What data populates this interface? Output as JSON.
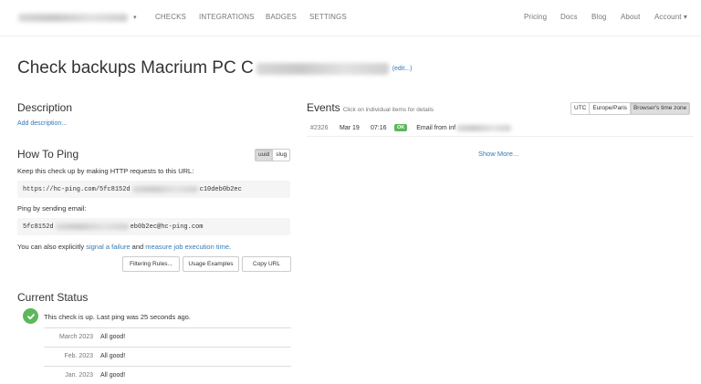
{
  "navbar": {
    "project_caret": "▾",
    "links_left": [
      "CHECKS",
      "INTEGRATIONS",
      "BADGES",
      "SETTINGS"
    ],
    "links_right": [
      "Pricing",
      "Docs",
      "Blog",
      "About"
    ],
    "account_label": "Account ▾"
  },
  "check": {
    "title": "Check backups Macrium PC C",
    "edit_label": "(edit...)"
  },
  "description": {
    "heading": "Description",
    "add_link": "Add description..."
  },
  "how_to_ping": {
    "heading": "How To Ping",
    "toggle_options": [
      "uuid",
      "slug"
    ],
    "toggle_selected": "uuid",
    "intro": "Keep this check up by making HTTP requests to this URL:",
    "url_prefix": "https://hc-ping.com/5fc8152d",
    "url_suffix": "c10deb0b2ec",
    "email_intro": "Ping by sending email:",
    "email_prefix": "5fc8152d",
    "email_suffix": "eb0b2ec@hc-ping.com",
    "explicit_prefix": "You can also explicitly",
    "signal_failure_link": "signal a failure",
    "explicit_and": "and",
    "measure_link": "measure job execution time",
    "explicit_suffix": ".",
    "buttons": [
      "Filtering Rules...",
      "Usage Examples",
      "Copy URL"
    ]
  },
  "current_status": {
    "heading": "Current Status",
    "status_text": "This check is up. Last ping was 25 seconds ago.",
    "months": [
      {
        "name": "March 2023",
        "value": "All good!"
      },
      {
        "name": "Feb. 2023",
        "value": "All good!"
      },
      {
        "name": "Jan. 2023",
        "value": "All good!"
      }
    ]
  },
  "events": {
    "heading": "Events",
    "subheading": "Click on individual items for details",
    "timezones": [
      "UTC",
      "Europe/Paris",
      "Browser's time zone"
    ],
    "timezone_selected": "Browser's time zone",
    "items": [
      {
        "id": "#2326",
        "date": "Mar 19",
        "time": "07:16",
        "badge": "OK",
        "details": "Email from inf"
      }
    ],
    "show_more": "Show More..."
  },
  "colors": {
    "link": "#337ab7",
    "success": "#5cb85c",
    "muted": "#777777",
    "code_bg": "#f5f5f5"
  }
}
